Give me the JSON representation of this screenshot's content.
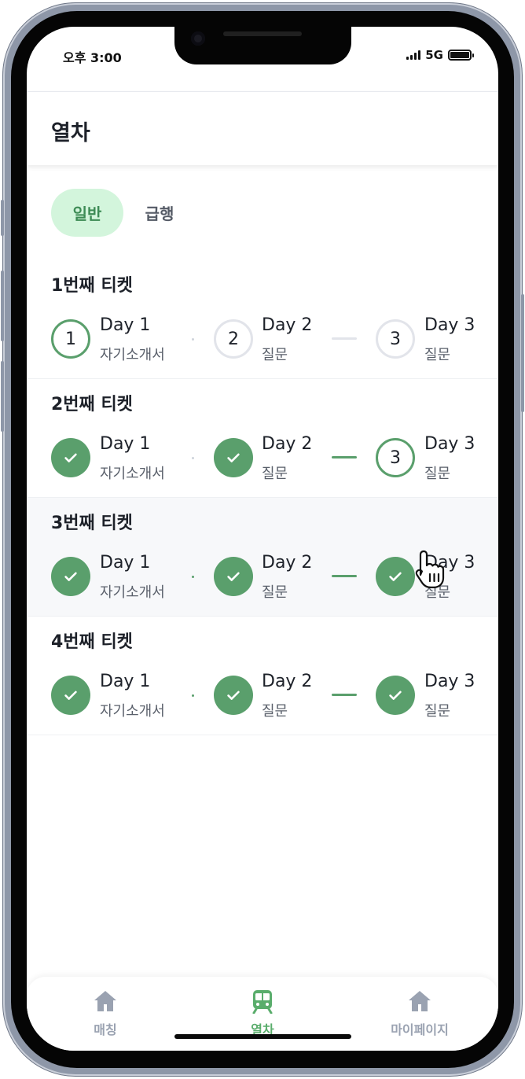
{
  "status_bar": {
    "time": "오후 3:00",
    "network": "5G"
  },
  "header": {
    "title": "열차"
  },
  "segments": [
    {
      "label": "일반",
      "active": true
    },
    {
      "label": "급행",
      "active": false
    }
  ],
  "tickets": [
    {
      "title": "1번째 티켓",
      "steps": [
        {
          "day": "Day 1",
          "topic": "자기소개서",
          "state": "current",
          "number": "1"
        },
        {
          "day": "Day 2",
          "topic": "질문",
          "state": "pending",
          "number": "2"
        },
        {
          "day": "Day 3",
          "topic": "질문",
          "state": "pending",
          "number": "3"
        }
      ]
    },
    {
      "title": "2번째 티켓",
      "steps": [
        {
          "day": "Day 1",
          "topic": "자기소개서",
          "state": "done"
        },
        {
          "day": "Day 2",
          "topic": "질문",
          "state": "done"
        },
        {
          "day": "Day 3",
          "topic": "질문",
          "state": "current",
          "number": "3"
        }
      ]
    },
    {
      "title": "3번째 티켓",
      "steps": [
        {
          "day": "Day 1",
          "topic": "자기소개서",
          "state": "done"
        },
        {
          "day": "Day 2",
          "topic": "질문",
          "state": "done"
        },
        {
          "day": "Day 3",
          "topic": "질문",
          "state": "done"
        }
      ]
    },
    {
      "title": "4번째 티켓",
      "steps": [
        {
          "day": "Day 1",
          "topic": "자기소개서",
          "state": "done"
        },
        {
          "day": "Day 2",
          "topic": "질문",
          "state": "done"
        },
        {
          "day": "Day 3",
          "topic": "질문",
          "state": "done"
        }
      ]
    }
  ],
  "tab_bar": {
    "items": [
      {
        "label": "매칭",
        "icon": "home-icon",
        "active": false
      },
      {
        "label": "열차",
        "icon": "train-icon",
        "active": true
      },
      {
        "label": "마이페이지",
        "icon": "home-icon",
        "active": false
      }
    ]
  },
  "colors": {
    "accent": "#5a9f6c",
    "active_tab": "#5aad6c",
    "segment_active_bg": "#d3f5dc",
    "inactive_tab": "#9aa2b1"
  }
}
